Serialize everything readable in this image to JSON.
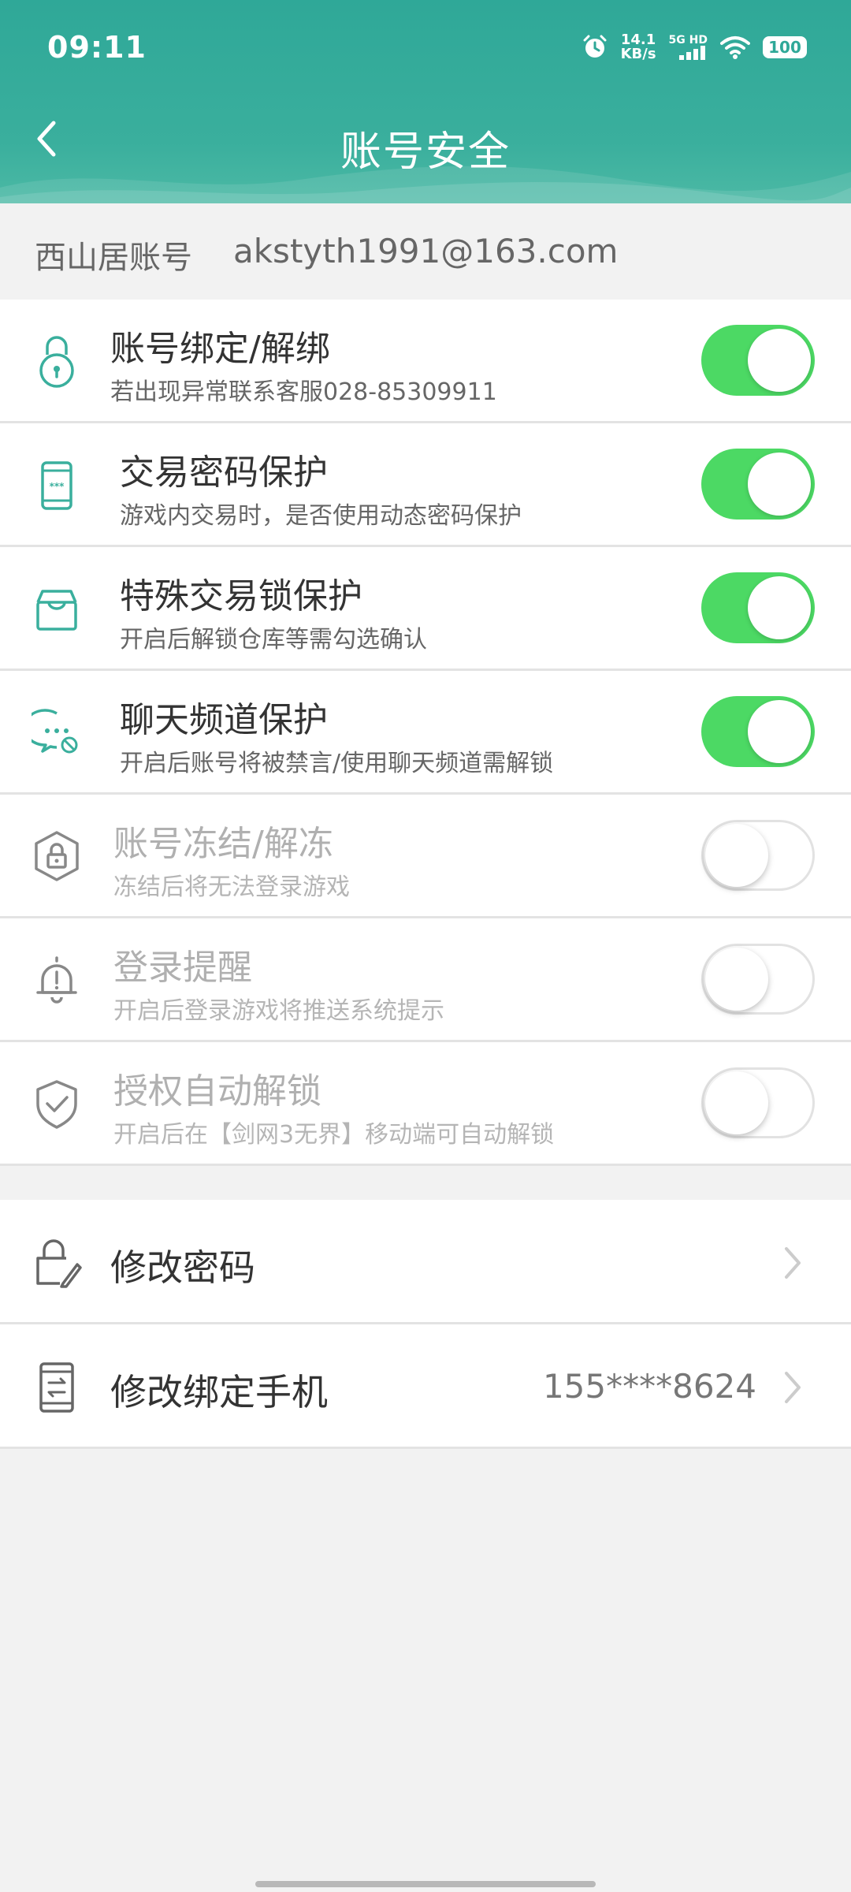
{
  "status_bar": {
    "time": "09:11",
    "net_speed_value": "14.1",
    "net_speed_unit": "KB/s",
    "net_type": "5G HD",
    "battery": "100"
  },
  "header": {
    "title": "账号安全",
    "bg_color": "#2fa898"
  },
  "account": {
    "label": "西山居账号",
    "email": "akstyth1991@163.com"
  },
  "toggles": [
    {
      "title": "账号绑定/解绑",
      "desc": "若出现异常联系客服028-85309911",
      "on": true,
      "icon": "lock-icon"
    },
    {
      "title": "交易密码保护",
      "desc": "游戏内交易时，是否使用动态密码保护",
      "on": true,
      "icon": "phone-password-icon"
    },
    {
      "title": "特殊交易锁保护",
      "desc": "开启后解锁仓库等需勾选确认",
      "on": true,
      "icon": "storage-box-icon"
    },
    {
      "title": "聊天频道保护",
      "desc": "开启后账号将被禁言/使用聊天频道需解锁",
      "on": true,
      "icon": "chat-ban-icon"
    },
    {
      "title": "账号冻结/解冻",
      "desc": "冻结后将无法登录游戏",
      "on": false,
      "icon": "hex-lock-icon"
    },
    {
      "title": "登录提醒",
      "desc": "开启后登录游戏将推送系统提示",
      "on": false,
      "icon": "bell-alert-icon"
    },
    {
      "title": "授权自动解锁",
      "desc": "开启后在【剑网3无界】移动端可自动解锁",
      "on": false,
      "icon": "shield-check-icon"
    }
  ],
  "nav": [
    {
      "label": "修改密码",
      "value": "",
      "icon": "lock-edit-icon"
    },
    {
      "label": "修改绑定手机",
      "value": "155****8624",
      "icon": "phone-swap-icon"
    }
  ],
  "colors": {
    "toggle_on": "#4cd964",
    "icon_active": "#3aaf9d",
    "icon_disabled": "#888888"
  }
}
